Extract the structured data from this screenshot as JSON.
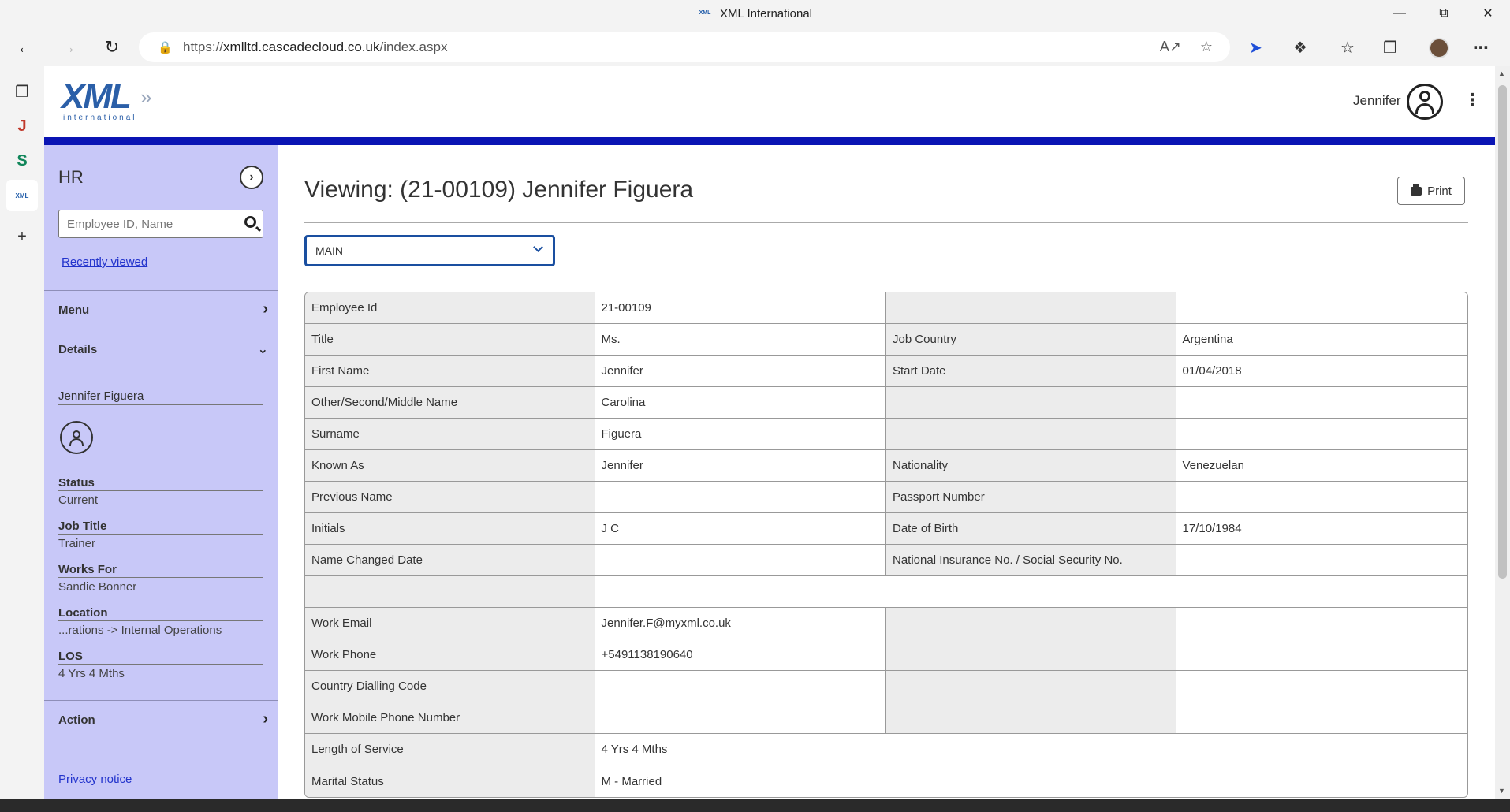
{
  "browser": {
    "window_title": "XML International",
    "favicon_text": "XML",
    "url_prefix": "https://",
    "url_host": "xmlltd.cascadecloud.co.uk",
    "url_path": "/index.aspx"
  },
  "header": {
    "logo_text": "XML",
    "logo_sub": "international",
    "user_name": "Jennifer"
  },
  "sidebar": {
    "title": "HR",
    "search_placeholder": "Employee ID, Name",
    "recently_viewed": "Recently viewed",
    "menu_label": "Menu",
    "details_label": "Details",
    "employee_name": "Jennifer Figuera",
    "info": [
      {
        "label": "Status",
        "value": "Current"
      },
      {
        "label": "Job Title",
        "value": "Trainer"
      },
      {
        "label": "Works For",
        "value": "Sandie Bonner"
      },
      {
        "label": "Location",
        "value": "...rations -> Internal Operations"
      },
      {
        "label": "LOS",
        "value": "4 Yrs 4 Mths"
      }
    ],
    "action_label": "Action",
    "privacy_notice": "Privacy notice"
  },
  "main": {
    "title": "Viewing:  (21-00109) Jennifer Figuera",
    "print_label": "Print",
    "section_selected": "MAIN"
  },
  "grid": {
    "rows": [
      {
        "l1": "Employee Id",
        "v1": "21-00109",
        "l2": "",
        "v2": ""
      },
      {
        "l1": "Title",
        "v1": "Ms.",
        "l2": "Job Country",
        "v2": "Argentina"
      },
      {
        "l1": "First Name",
        "v1": "Jennifer",
        "l2": "Start Date",
        "v2": "01/04/2018"
      },
      {
        "l1": "Other/Second/Middle Name",
        "v1": "Carolina",
        "l2": "",
        "v2": ""
      },
      {
        "l1": "Surname",
        "v1": "Figuera",
        "l2": "",
        "v2": ""
      },
      {
        "l1": "Known As",
        "v1": "Jennifer",
        "l2": "Nationality",
        "v2": "Venezuelan"
      },
      {
        "l1": "Previous Name",
        "v1": "",
        "l2": "Passport Number",
        "v2": ""
      },
      {
        "l1": "Initials",
        "v1": "J C",
        "l2": "Date of Birth",
        "v2": "17/10/1984"
      },
      {
        "l1": "Name Changed Date",
        "v1": "",
        "l2": "National Insurance No. / Social Security No.",
        "v2": ""
      },
      {
        "l1": "",
        "wide": ""
      },
      {
        "l1": "Work Email",
        "v1": "Jennifer.F@myxml.co.uk",
        "l2": "",
        "v2": ""
      },
      {
        "l1": "Work Phone",
        "v1": "+5491138190640",
        "l2": "",
        "v2": ""
      },
      {
        "l1": "Country Dialling Code",
        "v1": "",
        "l2": "",
        "v2": ""
      },
      {
        "l1": "Work Mobile Phone Number",
        "v1": "",
        "l2": "",
        "v2": ""
      },
      {
        "l1": "Length of Service",
        "wide": "4 Yrs 4 Mths"
      },
      {
        "l1": "Marital Status",
        "wide": "M - Married"
      }
    ]
  }
}
